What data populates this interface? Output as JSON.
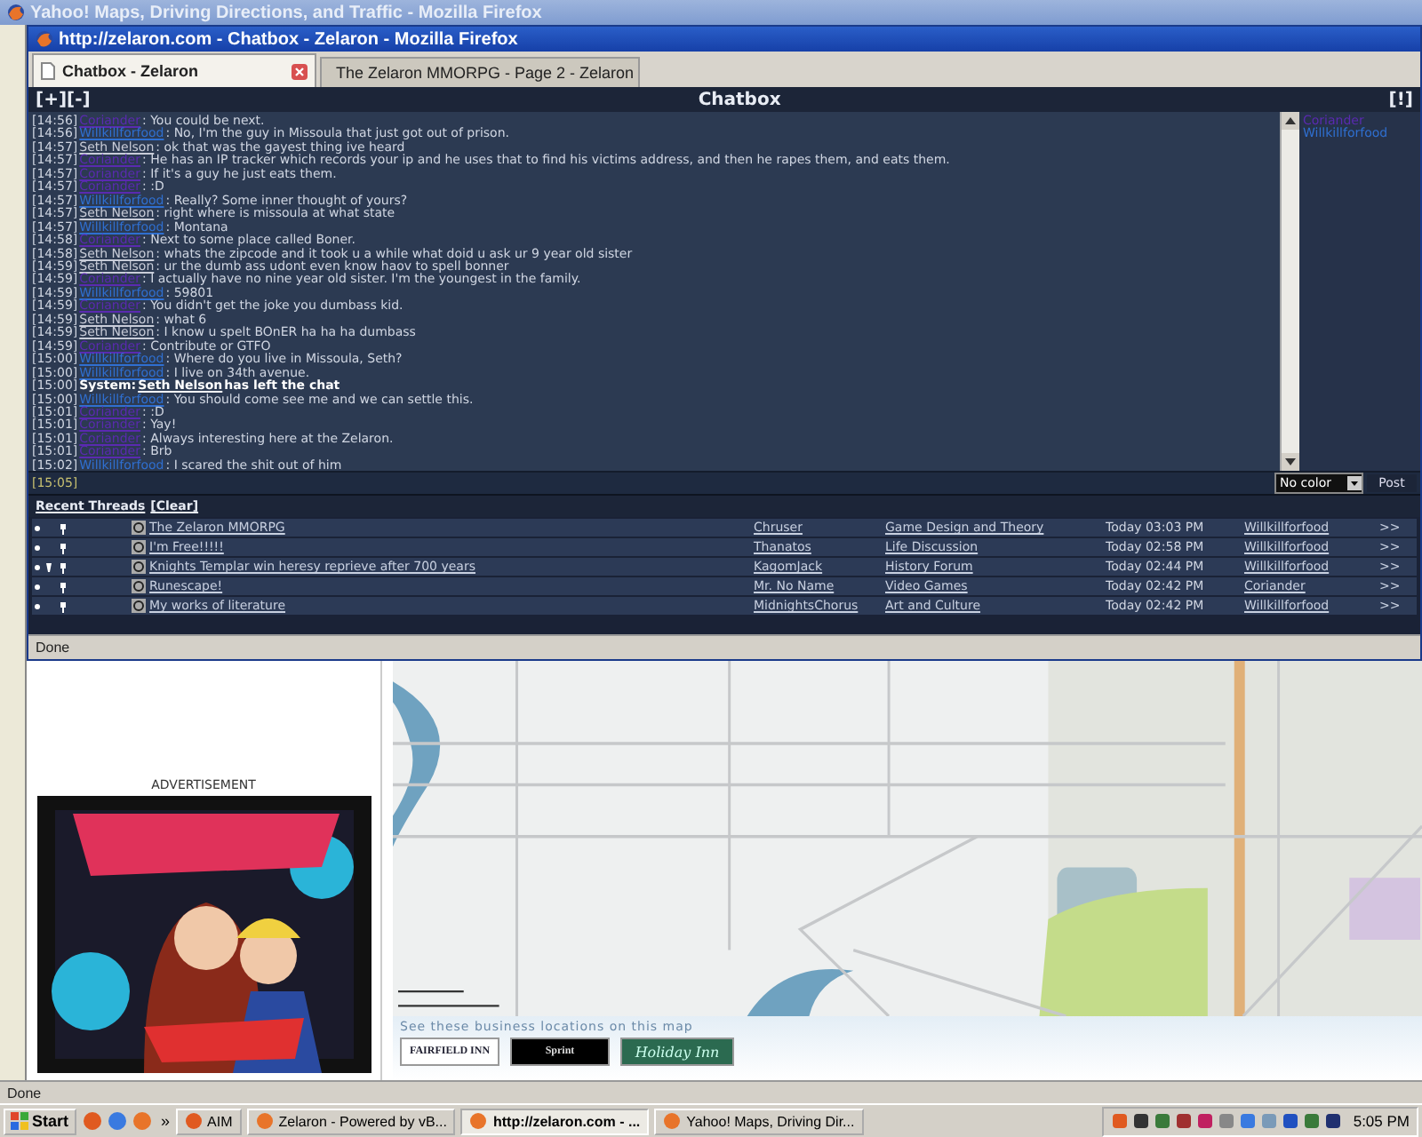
{
  "back_window": {
    "title": "Yahoo! Maps, Driving Directions, and Traffic - Mozilla Firefox"
  },
  "popup": {
    "title": "http://zelaron.com - Chatbox - Zelaron - Mozilla Firefox",
    "tabs": [
      {
        "label": "Chatbox - Zelaron",
        "selected": true
      },
      {
        "label": "The Zelaron MMORPG - Page 2 - Zelaron",
        "selected": false
      }
    ],
    "status": "Done"
  },
  "chatbox": {
    "title": "Chatbox",
    "left_controls": "[+][-]",
    "right_control": "[!]",
    "messages": [
      {
        "kind": "message",
        "time": "[14:56]",
        "author": "Coriander",
        "color": "#5a2ab0",
        "text": ": You could be next."
      },
      {
        "kind": "message",
        "time": "[14:56]",
        "author": "Willkillforfood",
        "color": "#2f6fd0",
        "text": ": No, I'm the guy in Missoula that just got out of prison."
      },
      {
        "kind": "message",
        "time": "[14:57]",
        "author": "Seth Nelson",
        "color": "#c8ccd8",
        "text": ": ok that was the gayest thing ive heard"
      },
      {
        "kind": "message",
        "time": "[14:57]",
        "author": "Coriander",
        "color": "#5a2ab0",
        "text": ": He has an IP tracker which records your ip and he uses that to find his victims address, and then he rapes them, and eats them."
      },
      {
        "kind": "message",
        "time": "[14:57]",
        "author": "Coriander",
        "color": "#5a2ab0",
        "text": ": If it's a guy he just eats them."
      },
      {
        "kind": "message",
        "time": "[14:57]",
        "author": "Coriander",
        "color": "#5a2ab0",
        "text": ": :D"
      },
      {
        "kind": "message",
        "time": "[14:57]",
        "author": "Willkillforfood",
        "color": "#2f6fd0",
        "text": ": Really? Some inner thought of yours?"
      },
      {
        "kind": "message",
        "time": "[14:57]",
        "author": "Seth Nelson",
        "color": "#c8ccd8",
        "text": ": right where is missoula at what state"
      },
      {
        "kind": "message",
        "time": "[14:57]",
        "author": "Willkillforfood",
        "color": "#2f6fd0",
        "text": ": Montana"
      },
      {
        "kind": "message",
        "time": "[14:58]",
        "author": "Coriander",
        "color": "#5a2ab0",
        "text": ": Next to some place called Boner."
      },
      {
        "kind": "message",
        "time": "[14:58]",
        "author": "Seth Nelson",
        "color": "#c8ccd8",
        "text": ": whats the zipcode and it took u a while what doid u ask ur 9 year old sister"
      },
      {
        "kind": "message",
        "time": "[14:59]",
        "author": "Seth Nelson",
        "color": "#c8ccd8",
        "text": ": ur the dumb ass udont even know haov to spell bonner"
      },
      {
        "kind": "message",
        "time": "[14:59]",
        "author": "Coriander",
        "color": "#5a2ab0",
        "text": ": I actually have no nine year old sister. I'm the youngest in the family."
      },
      {
        "kind": "message",
        "time": "[14:59]",
        "author": "Willkillforfood",
        "color": "#2f6fd0",
        "text": ": 59801"
      },
      {
        "kind": "message",
        "time": "[14:59]",
        "author": "Coriander",
        "color": "#5a2ab0",
        "text": ": You didn't get the joke you dumbass kid."
      },
      {
        "kind": "message",
        "time": "[14:59]",
        "author": "Seth Nelson",
        "color": "#c8ccd8",
        "text": ": what 6"
      },
      {
        "kind": "message",
        "time": "[14:59]",
        "author": "Seth Nelson",
        "color": "#c8ccd8",
        "text": ": I know u spelt BOnER ha ha ha dumbass"
      },
      {
        "kind": "message",
        "time": "[14:59]",
        "author": "Coriander",
        "color": "#5a2ab0",
        "text": ": Contribute or GTFO"
      },
      {
        "kind": "message",
        "time": "[15:00]",
        "author": "Willkillforfood",
        "color": "#2f6fd0",
        "text": ": Where do you live in Missoula, Seth?"
      },
      {
        "kind": "message",
        "time": "[15:00]",
        "author": "Willkillforfood",
        "color": "#2f6fd0",
        "text": ": I live on 34th avenue."
      },
      {
        "kind": "system",
        "time": "[15:00]",
        "label": "System:",
        "author": "Seth Nelson",
        "text": "has left the chat"
      },
      {
        "kind": "message",
        "time": "[15:00]",
        "author": "Willkillforfood",
        "color": "#2f6fd0",
        "text": ": You should come see me and we can settle this."
      },
      {
        "kind": "message",
        "time": "[15:01]",
        "author": "Coriander",
        "color": "#5a2ab0",
        "text": ": :D"
      },
      {
        "kind": "message",
        "time": "[15:01]",
        "author": "Coriander",
        "color": "#5a2ab0",
        "text": ": Yay!"
      },
      {
        "kind": "message",
        "time": "[15:01]",
        "author": "Coriander",
        "color": "#5a2ab0",
        "text": ": Always interesting here at the Zelaron."
      },
      {
        "kind": "message",
        "time": "[15:01]",
        "author": "Coriander",
        "color": "#5a2ab0",
        "text": ": Brb"
      },
      {
        "kind": "message",
        "time": "[15:02]",
        "author": "Willkillforfood",
        "color": "#2f6fd0",
        "text": ": I scared the shit out of him"
      }
    ],
    "online": [
      {
        "name": "Coriander",
        "color": "#5a2ab0"
      },
      {
        "name": "Willkillforfood",
        "color": "#2f6fd0"
      }
    ],
    "input_time": "[15:05]",
    "color_select": "No color",
    "post_button": "Post"
  },
  "recent_threads": {
    "title": "Recent Threads",
    "clear": "[Clear]",
    "rows": [
      {
        "kind": "single",
        "title": "The Zelaron MMORPG",
        "author": "Chruser",
        "forum": "Game Design and Theory",
        "date": "Today 03:03 PM",
        "last_poster": "Willkillforfood",
        "go": ">>"
      },
      {
        "kind": "single",
        "title": "I'm Free!!!!!",
        "author": "Thanatos",
        "forum": "Life Discussion",
        "date": "Today 02:58 PM",
        "last_poster": "Willkillforfood",
        "go": ">>"
      },
      {
        "kind": "multi",
        "title": "Knights Templar win heresy reprieve after 700 years",
        "author": "KagomJack",
        "forum": "History Forum",
        "date": "Today 02:44 PM",
        "last_poster": "Willkillforfood",
        "go": ">>"
      },
      {
        "kind": "single",
        "title": "Runescape!",
        "author": "Mr. No Name",
        "forum": "Video Games",
        "date": "Today 02:42 PM",
        "last_poster": "Coriander",
        "go": ">>"
      },
      {
        "kind": "single",
        "title": "My works of literature",
        "author": "MidnightsChorus",
        "forum": "Art and Culture",
        "date": "Today 02:42 PM",
        "last_poster": "Willkillforfood",
        "go": ">>"
      }
    ]
  },
  "ad": {
    "label": "ADVERTISEMENT"
  },
  "map": {
    "businesses_caption": "See these business locations on this map",
    "logos": [
      "FAIRFIELD INN",
      "Sprint",
      "Holiday Inn"
    ]
  },
  "status_bar": "Done",
  "taskbar": {
    "start": "Start",
    "more": "»",
    "buttons": [
      {
        "label": "AIM",
        "selected": false
      },
      {
        "label": "Zelaron - Powered by vB...",
        "selected": false
      },
      {
        "label": "http://zelaron.com - ...",
        "selected": true
      },
      {
        "label": "Yahoo! Maps, Driving Dir...",
        "selected": false
      }
    ],
    "clock": "5:05 PM"
  }
}
